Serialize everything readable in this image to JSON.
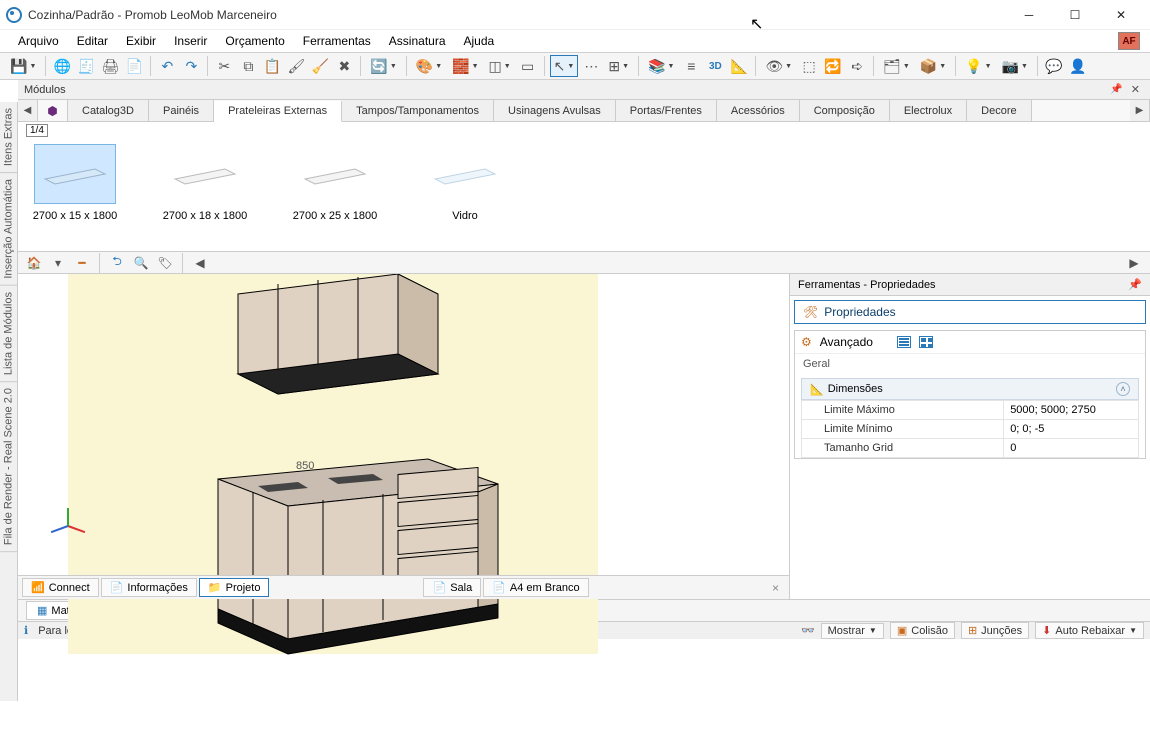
{
  "window": {
    "title": "Cozinha/Padrão - Promob LeoMob Marceneiro",
    "af_badge": "AF"
  },
  "menu": {
    "items": [
      "Arquivo",
      "Editar",
      "Exibir",
      "Inserir",
      "Orçamento",
      "Ferramentas",
      "Assinatura",
      "Ajuda"
    ]
  },
  "modules_panel": {
    "title": "Módulos"
  },
  "module_tabs": {
    "items": [
      "Catalog3D",
      "Painéis",
      "Prateleiras Externas",
      "Tampos/Tamponamentos",
      "Usinagens Avulsas",
      "Portas/Frentes",
      "Acessórios",
      "Composição",
      "Electrolux",
      "Decore"
    ],
    "active_index": 2
  },
  "thumb_strip": {
    "page": "1/4",
    "items": [
      {
        "label": "2700 x 15 x 1800",
        "selected": true
      },
      {
        "label": "2700 x 18 x 1800",
        "selected": false
      },
      {
        "label": "2700 x 25 x 1800",
        "selected": false
      },
      {
        "label": "Vidro",
        "selected": false
      }
    ]
  },
  "scene_label": "850",
  "viewport_tabs": {
    "items": [
      {
        "label": "Connect",
        "icon": "rss"
      },
      {
        "label": "Informações",
        "icon": "info"
      },
      {
        "label": "Projeto",
        "icon": "folder",
        "active": true
      },
      {
        "label": "Sala",
        "icon": "page"
      },
      {
        "label": "A4 em Branco",
        "icon": "page"
      }
    ]
  },
  "left_tabs": [
    "Itens Extras",
    "Inserção Automática",
    "Lista de Módulos",
    "Fila de Render - Real Scene 2.0"
  ],
  "bottom_tabs": [
    "Materiais"
  ],
  "properties": {
    "panel_title": "Ferramentas - Propriedades",
    "button": "Propriedades",
    "advanced": "Avançado",
    "geral": "Geral",
    "group": "Dimensões",
    "rows": [
      {
        "k": "Limite Máximo",
        "v": "5000; 5000; 2750"
      },
      {
        "k": "Limite Mínimo",
        "v": "0; 0; -5"
      },
      {
        "k": "Tamanho Grid",
        "v": "0"
      }
    ]
  },
  "status": {
    "info_icon": "ℹ",
    "text": "Para localizar um módulo, utilize a ferramenta Localizar Rápido.",
    "buttons": [
      {
        "label": "Mostrar",
        "icon": "👓",
        "drop": true
      },
      {
        "label": "Colisão",
        "icon": "📦"
      },
      {
        "label": "Junções",
        "icon": "🔗"
      },
      {
        "label": "Auto Rebaixar",
        "icon": "⬇"
      }
    ]
  }
}
